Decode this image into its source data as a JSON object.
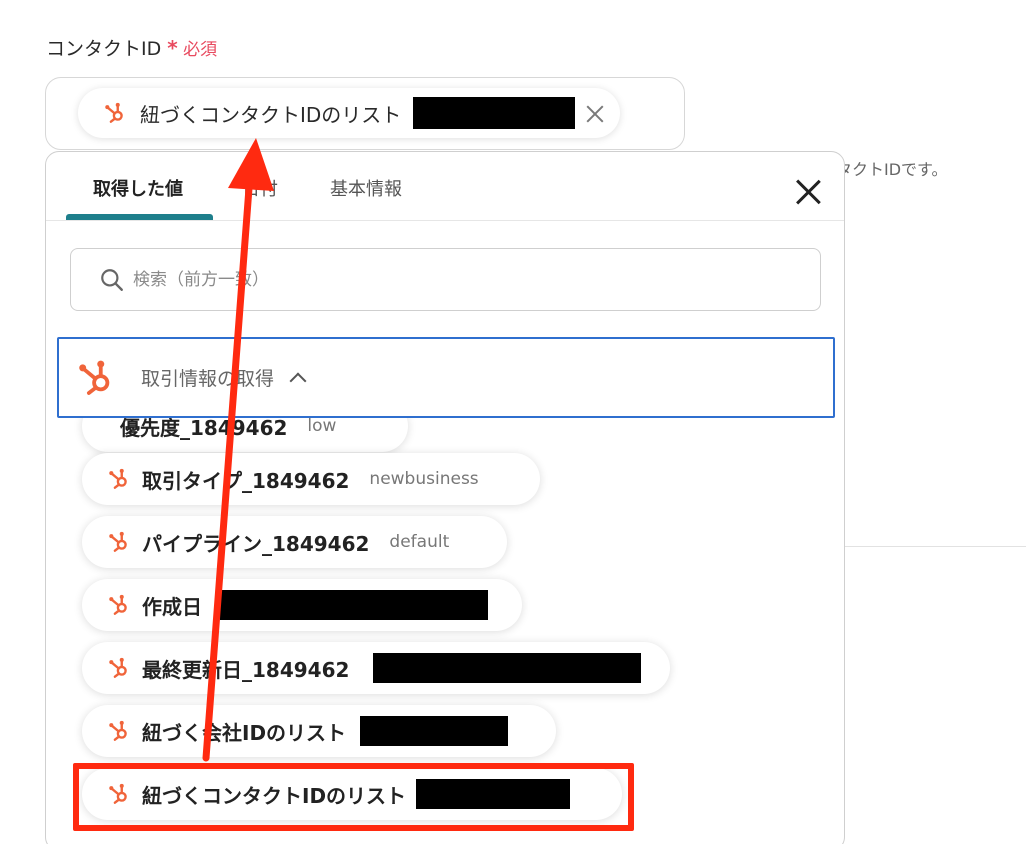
{
  "field": {
    "label": "コンタクトID",
    "required_star": "*",
    "required_text": "必須",
    "chip_label": "紐づくコンタクトIDのリスト",
    "help_text": "タクトIDです。"
  },
  "panel": {
    "tabs": [
      {
        "label": "取得した値",
        "active": true
      },
      {
        "label": "日付"
      },
      {
        "label": "基本情報"
      }
    ],
    "search_placeholder": "検索（前方一致）",
    "group": {
      "label": "取引情報の取得"
    },
    "items": [
      {
        "name": "優先度_1849462",
        "value": "low"
      },
      {
        "name": "取引タイプ_1849462",
        "value": "newbusiness"
      },
      {
        "name": "パイプライン_1849462",
        "value": "default"
      },
      {
        "name": "作成日",
        "value": ""
      },
      {
        "name": "最終更新日_1849462",
        "value": ""
      },
      {
        "name": "紐づく会社IDのリスト",
        "value": ""
      },
      {
        "name": "紐づくコンタクトIDのリスト",
        "value": ""
      }
    ]
  },
  "annotation": {
    "color": "#ff2a10"
  },
  "colors": {
    "accent": "#1e7f8c",
    "focus": "#2f6fcf",
    "hubspot": "#f0643a",
    "required": "#e84a5f"
  }
}
